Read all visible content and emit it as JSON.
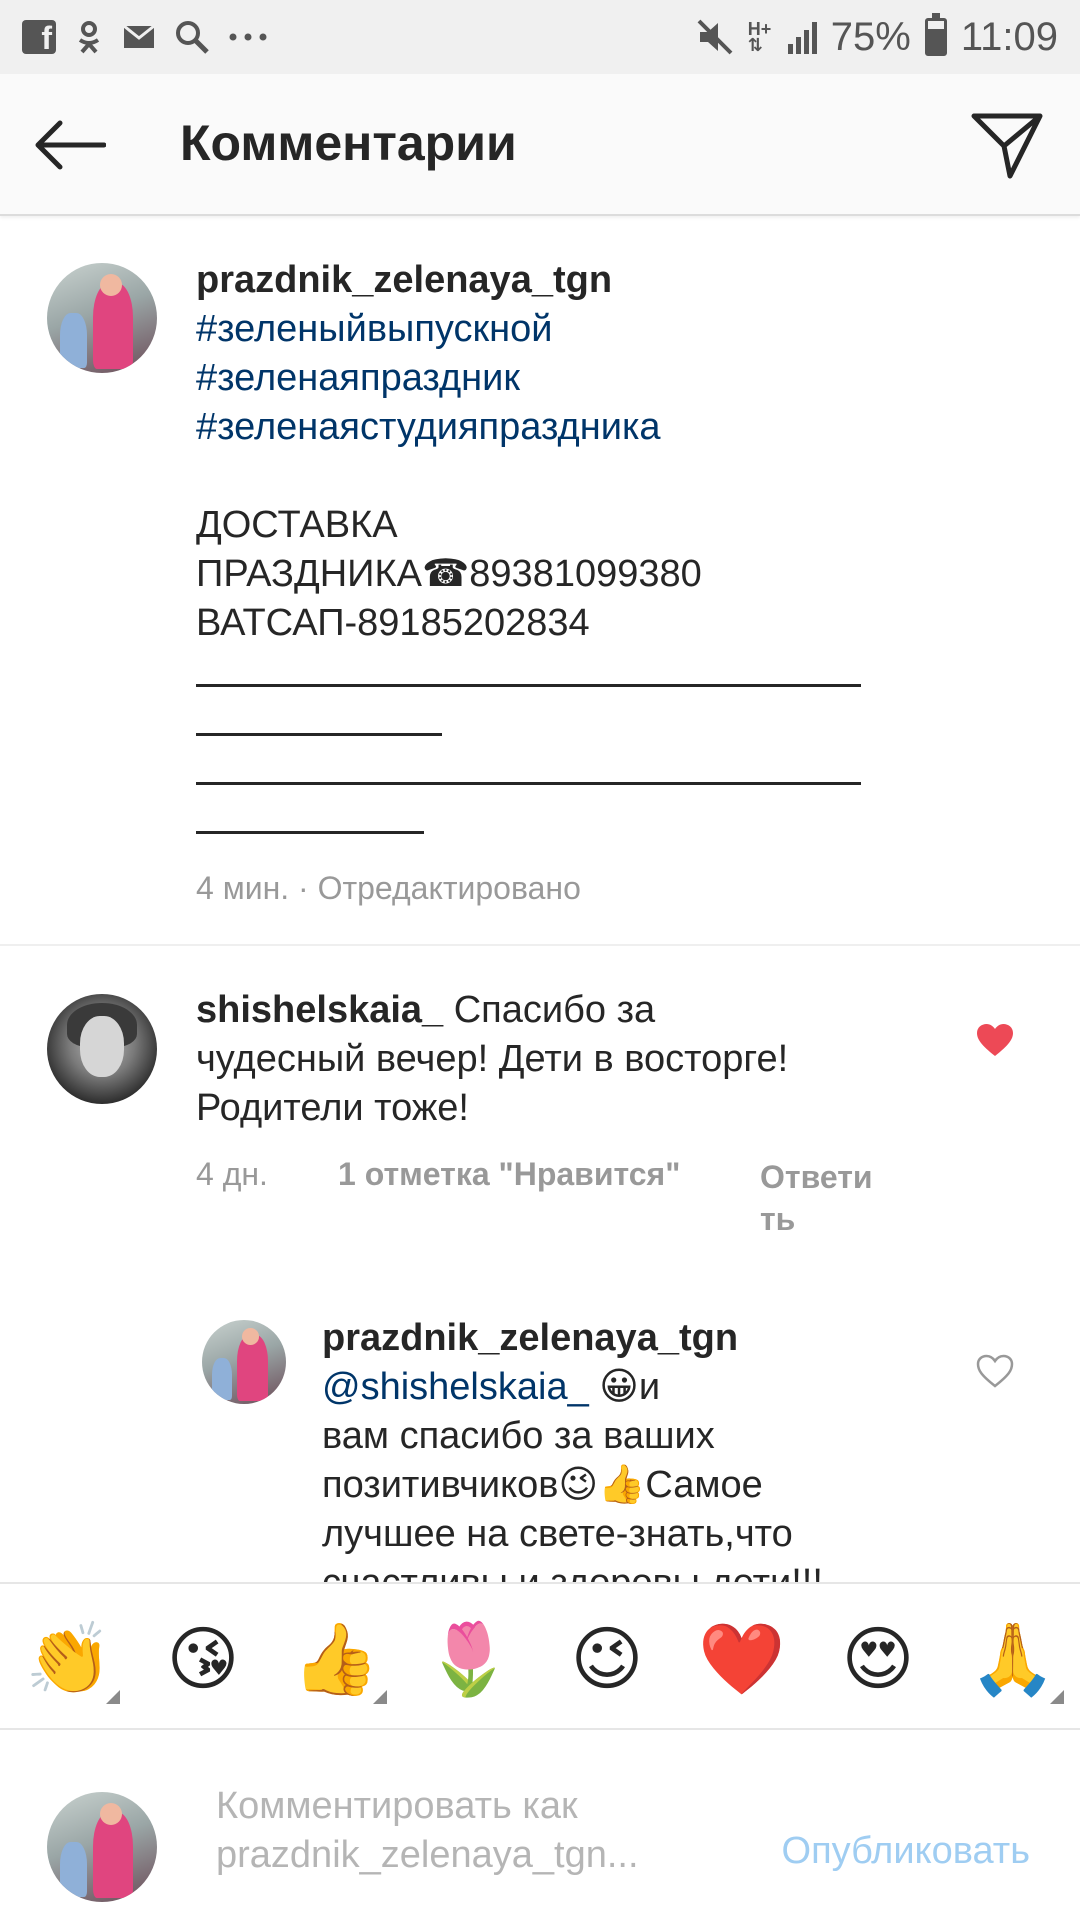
{
  "status_bar": {
    "battery": "75%",
    "time": "11:09",
    "network": "H+",
    "battery_level": 0.75,
    "icons": [
      "facebook-icon",
      "ok-icon",
      "mail-icon",
      "search-icon",
      "more-icon",
      "mute-icon",
      "network-icon",
      "signal-icon",
      "battery-icon"
    ]
  },
  "header": {
    "title": "Комментарии",
    "back_icon": "arrow-left-icon",
    "send_icon": "paper-plane-icon"
  },
  "caption": {
    "username": "prazdnik_zelenaya_tgn",
    "hashtags": [
      "#зеленыйвыпускной",
      "#зеленаяпраздник",
      "#зеленаястудияпраздника"
    ],
    "lines": [
      "ДОСТАВКА",
      "ПРАЗДНИКА☎89381099380",
      "ВАТСАП-89185202834"
    ],
    "meta": "4 мин. · Отредактировано"
  },
  "comment": {
    "username": "shishelskaia_",
    "text_first": "Спасибо за",
    "text_lines": [
      "чудесный вечер! Дети в восторге!",
      "Родители тоже!"
    ],
    "time": "4 дн.",
    "likes": "1 отметка \"Нравится\"",
    "reply_line1": "Ответи",
    "reply_line2": "ть",
    "liked": true,
    "heart_color": "#ed4956"
  },
  "reply": {
    "username": "prazdnik_zelenaya_tgn",
    "mention": "@shishelskaia_",
    "after_mention": " 😀и",
    "lines": [
      "вам спасибо за ваших",
      "позитивчиков😉👍Самое",
      "лучшее на свете-знать,что",
      "счастливы и здоровы дети!!!"
    ],
    "liked": false
  },
  "emoji_bar": [
    {
      "glyph": "👏",
      "name": "clapping-hands-emoji"
    },
    {
      "glyph": "😘",
      "name": "kiss-face-emoji"
    },
    {
      "glyph": "👍",
      "name": "thumbs-up-emoji"
    },
    {
      "glyph": "🌷",
      "name": "tulip-emoji"
    },
    {
      "glyph": "😉",
      "name": "wink-face-emoji"
    },
    {
      "glyph": "❤️",
      "name": "red-heart-emoji"
    },
    {
      "glyph": "😍",
      "name": "heart-eyes-emoji"
    },
    {
      "glyph": "🙏",
      "name": "folded-hands-emoji"
    }
  ],
  "composer": {
    "placeholder_line1": "Комментировать как",
    "placeholder_line2": "prazdnik_zelenaya_tgn...",
    "publish_label": "Опубликовать",
    "publish_color": "#9fcdf2"
  }
}
